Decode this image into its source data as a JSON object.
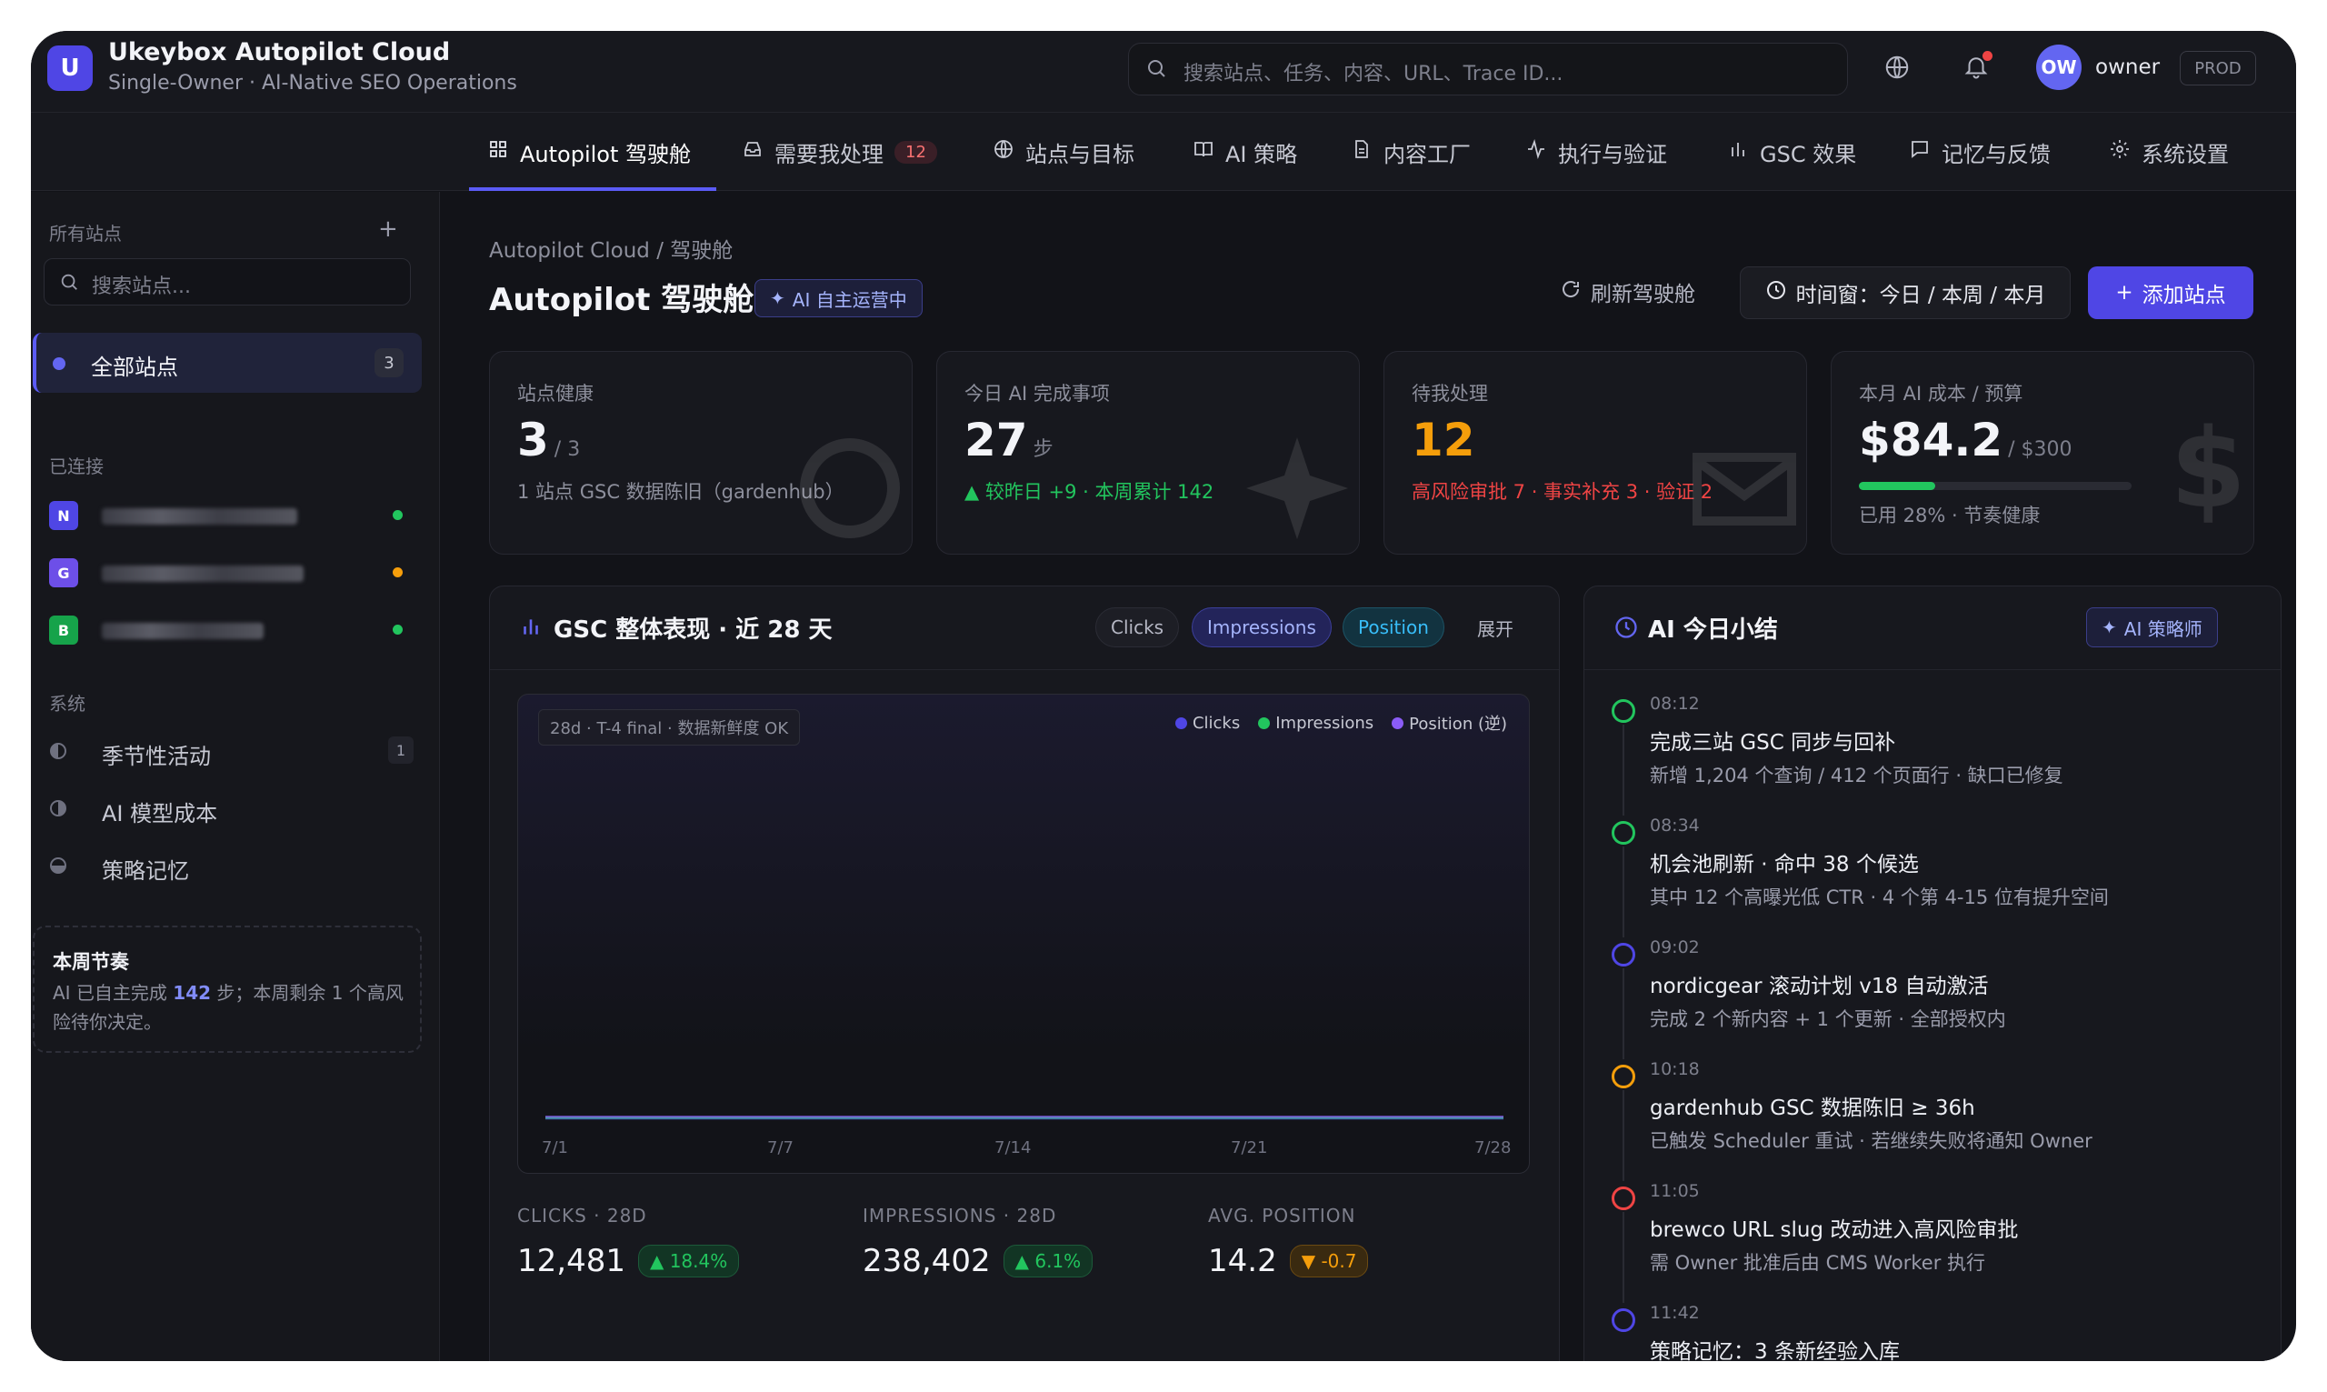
{
  "app": {
    "logo_letter": "U",
    "title": "Ukeybox Autopilot Cloud",
    "subtitle": "Single-Owner · AI-Native SEO Operations",
    "search_placeholder": "搜索站点、任务、内容、URL、Trace ID...",
    "avatar_initials": "OW",
    "user_name": "owner",
    "env_badge": "PROD"
  },
  "tabs": [
    {
      "label": "Autopilot 驾驶舱",
      "icon": "grid-icon",
      "active": true
    },
    {
      "label": "需要我处理",
      "icon": "inbox-icon",
      "badge": "12"
    },
    {
      "label": "站点与目标",
      "icon": "globe-icon"
    },
    {
      "label": "AI 策略",
      "icon": "book-icon"
    },
    {
      "label": "内容工厂",
      "icon": "document-icon"
    },
    {
      "label": "执行与验证",
      "icon": "activity-icon"
    },
    {
      "label": "GSC 效果",
      "icon": "bar-chart-icon"
    },
    {
      "label": "记忆与反馈",
      "icon": "message-icon"
    },
    {
      "label": "系统设置",
      "icon": "gear-icon"
    }
  ],
  "sidebar": {
    "all_sites_header": "所有站点",
    "search_placeholder": "搜索站点...",
    "all_sites_label": "全部站点",
    "all_sites_count": "3",
    "connected_header": "已连接",
    "sites": [
      {
        "initial": "N",
        "color": "#4f46e5",
        "status_color": "#22c55e"
      },
      {
        "initial": "G",
        "color": "#6d4fe8",
        "status_color": "#f59e0b"
      },
      {
        "initial": "B",
        "color": "#16a34a",
        "status_color": "#22c55e"
      }
    ],
    "system_header": "系统",
    "system_items": [
      {
        "label": "季节性活动",
        "count": "1"
      },
      {
        "label": "AI 模型成本"
      },
      {
        "label": "策略记忆"
      }
    ],
    "weekly_title": "本周节奏",
    "weekly_text_before": "AI 已自主完成 ",
    "weekly_highlight": "142",
    "weekly_text_after": " 步；本周剩余 1 个高风险待你决定。"
  },
  "main": {
    "breadcrumb": "Autopilot Cloud / 驾驶舱",
    "title": "Autopilot 驾驶舱",
    "ai_status": "AI 自主运营中",
    "refresh_label": "刷新驾驶舱",
    "time_window_label": "时间窗：今日 / 本周 / 本月",
    "add_site_label": "添加站点"
  },
  "kpis": [
    {
      "label": "站点健康",
      "value": "3",
      "unit": "/ 3",
      "sub": "1 站点 GSC 数据陈旧（gardenhub）",
      "sub_color": "#8d8f9c",
      "value_color": "#f3f4f8"
    },
    {
      "label": "今日 AI 完成事项",
      "value": "27",
      "unit": "步",
      "sub": "▲ 较昨日 +9 · 本周累计 142",
      "sub_color": "#22c55e",
      "value_color": "#f3f4f8"
    },
    {
      "label": "待我处理",
      "value": "12",
      "unit": "",
      "sub": "高风险审批 7 · 事实补充 3 · 验证 2",
      "sub_color": "#ef4444",
      "value_color": "#f59e0b"
    },
    {
      "label": "本月 AI 成本 / 预算",
      "value": "$84.2",
      "unit": "/ $300",
      "sub": "已用 28% · 节奏健康",
      "sub_color": "#8d8f9c",
      "value_color": "#f3f4f8",
      "progress": 0.28
    }
  ],
  "gsc": {
    "title": "GSC 整体表现 · 近 28 天",
    "chips": [
      "Clicks",
      "Impressions",
      "Position"
    ],
    "expand_label": "展开",
    "freshness": "28d · T-4 final · 数据新鲜度 OK",
    "stats": [
      {
        "label": "CLICKS · 28D",
        "value": "12,481",
        "delta": "▲ 18.4%",
        "delta_color": "#22c55e",
        "delta_bg": "#123524"
      },
      {
        "label": "IMPRESSIONS · 28D",
        "value": "238,402",
        "delta": "▲ 6.1%",
        "delta_color": "#22c55e",
        "delta_bg": "#123524"
      },
      {
        "label": "AVG. POSITION",
        "value": "14.2",
        "delta": "▼ -0.7",
        "delta_color": "#f59e0b",
        "delta_bg": "#3a2a10"
      }
    ]
  },
  "chart_data": {
    "type": "line",
    "title": "",
    "x": [
      "7/1",
      "7/7",
      "7/14",
      "7/21",
      "7/28"
    ],
    "series": [
      {
        "name": "Clicks",
        "color": "#4f46e5",
        "values": [
          0,
          0,
          0,
          0,
          0
        ]
      },
      {
        "name": "Impressions",
        "color": "#22c55e",
        "values": [
          0,
          0,
          0,
          0,
          0
        ]
      },
      {
        "name": "Position (逆)",
        "color": "#8b5cf6",
        "values": [
          0,
          0,
          0,
          0,
          0
        ]
      }
    ],
    "legend": "top-right",
    "grid": false
  },
  "summary": {
    "title": "AI 今日小结",
    "strategist_label": "AI 策略师",
    "items": [
      {
        "time": "08:12",
        "title": "完成三站 GSC 同步与回补",
        "desc": "新增 1,204 个查询 / 412 个页面行 · 缺口已修复",
        "color": "#22c55e"
      },
      {
        "time": "08:34",
        "title": "机会池刷新 · 命中 38 个候选",
        "desc": "其中 12 个高曝光低 CTR · 4 个第 4-15 位有提升空间",
        "color": "#22c55e"
      },
      {
        "time": "09:02",
        "title": "nordicgear 滚动计划 v18 自动激活",
        "desc": "完成 2 个新内容 + 1 个更新 · 全部授权内",
        "color": "#4f46e5"
      },
      {
        "time": "10:18",
        "title": "gardenhub GSC 数据陈旧 ≥ 36h",
        "desc": "已触发 Scheduler 重试 · 若继续失败将通知 Owner",
        "color": "#f59e0b"
      },
      {
        "time": "11:05",
        "title": "brewco URL slug 改动进入高风险审批",
        "desc": "需 Owner 批准后由 CMS Worker 执行",
        "color": "#ef4444"
      },
      {
        "time": "11:42",
        "title": "策略记忆：3 条新经验入库",
        "desc": "",
        "color": "#4f46e5"
      }
    ]
  }
}
